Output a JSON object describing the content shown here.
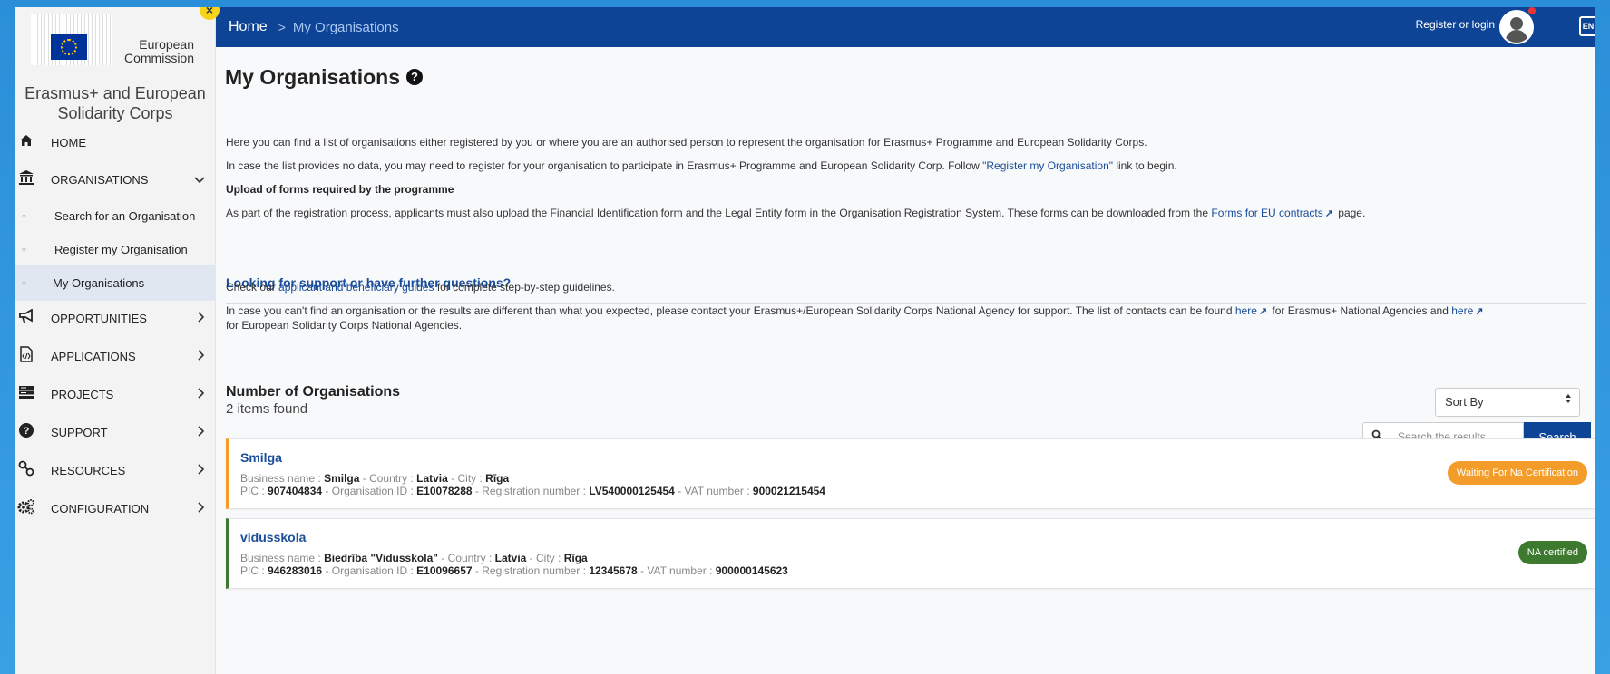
{
  "colors": {
    "brand": "#0e4496",
    "pending": "#f39c2a",
    "certified": "#3d7a30"
  },
  "logo": {
    "text_line1": "European",
    "text_line2": "Commission"
  },
  "close_badge": "×",
  "app_title": "Erasmus+ and European Solidarity Corps",
  "nav": {
    "home": "HOME",
    "organisations": "ORGANISATIONS",
    "sub_search": "Search for an Organisation",
    "sub_register": "Register my Organisation",
    "sub_my": "My Organisations",
    "opportunities": "OPPORTUNITIES",
    "applications": "APPLICATIONS",
    "projects": "PROJECTS",
    "support": "SUPPORT",
    "resources": "RESOURCES",
    "configuration": "CONFIGURATION"
  },
  "header": {
    "breadcrumb_home": "Home",
    "breadcrumb_sep": ">",
    "breadcrumb_current": "My Organisations",
    "login": "Register or login",
    "lang": "EN"
  },
  "main": {
    "title": "My Organisations",
    "help": "?",
    "p1": "Here you can find a list of organisations either registered by you or where you are an authorised person to represent the organisation for Erasmus+ Programme and European Solidarity Corps.",
    "p2_a": "In case the list provides no data, you may need to register for your organisation to participate in Erasmus+ Programme and European Solidarity Corp. Follow ",
    "p2_link": "\"Register my Organisation\"",
    "p2_b": " link to begin.",
    "upload_title": "Upload of forms required by the programme",
    "p3_a": "As part of the registration process, applicants must also upload the Financial Identification form and the Legal Entity form in the Organisation Registration System. These forms can be downloaded from the ",
    "p3_link": "Forms for EU contracts",
    "p3_b": " page.",
    "support_title": "Looking for support or have further questions?",
    "p4_a": "Check our ",
    "p4_link": "applicant and beneficiary guides",
    "p4_b": " for complete step-by-step guidelines.",
    "p5_a": "In case you can't find an organisation or the results are different than what you expected, please contact your Erasmus+/European Solidarity Corps National Agency for support. The list of contacts can be found ",
    "p5_link1": "here",
    "p5_b": " for Erasmus+ National Agencies and ",
    "p5_link2": "here",
    "p5_c": "for European Solidarity Corps National Agencies.",
    "count_title": "Number of Organisations",
    "count_sub": "2 items found",
    "sort_label": "Sort By",
    "search_placeholder": "Search the results...",
    "search_button": "Search"
  },
  "organisations": [
    {
      "name": "Smilga",
      "business_name_label": "Business name :",
      "business_name": "Smilga",
      "country_label": "- Country :",
      "country": "Latvia",
      "city_label": "- City :",
      "city": "Rīga",
      "pic_label": "PIC :",
      "pic": "907404834",
      "org_id_label": "- Organisation ID :",
      "org_id": "E10078288",
      "reg_label": "- Registration number :",
      "reg": "LV540000125454",
      "vat_label": "- VAT number :",
      "vat": "900021215454",
      "status": "Waiting For Na Certification",
      "status_color": "#f39c2a"
    },
    {
      "name": "vidusskola",
      "business_name_label": "Business name :",
      "business_name": "Biedrība \"Vidusskola\"",
      "country_label": "- Country :",
      "country": "Latvia",
      "city_label": "- City :",
      "city": "Rīga",
      "pic_label": "PIC :",
      "pic": "946283016",
      "org_id_label": "- Organisation ID :",
      "org_id": "E10096657",
      "reg_label": "- Registration number :",
      "reg": "12345678",
      "vat_label": "- VAT number :",
      "vat": "900000145623",
      "status": "NA certified",
      "status_color": "#3d7a30"
    }
  ]
}
